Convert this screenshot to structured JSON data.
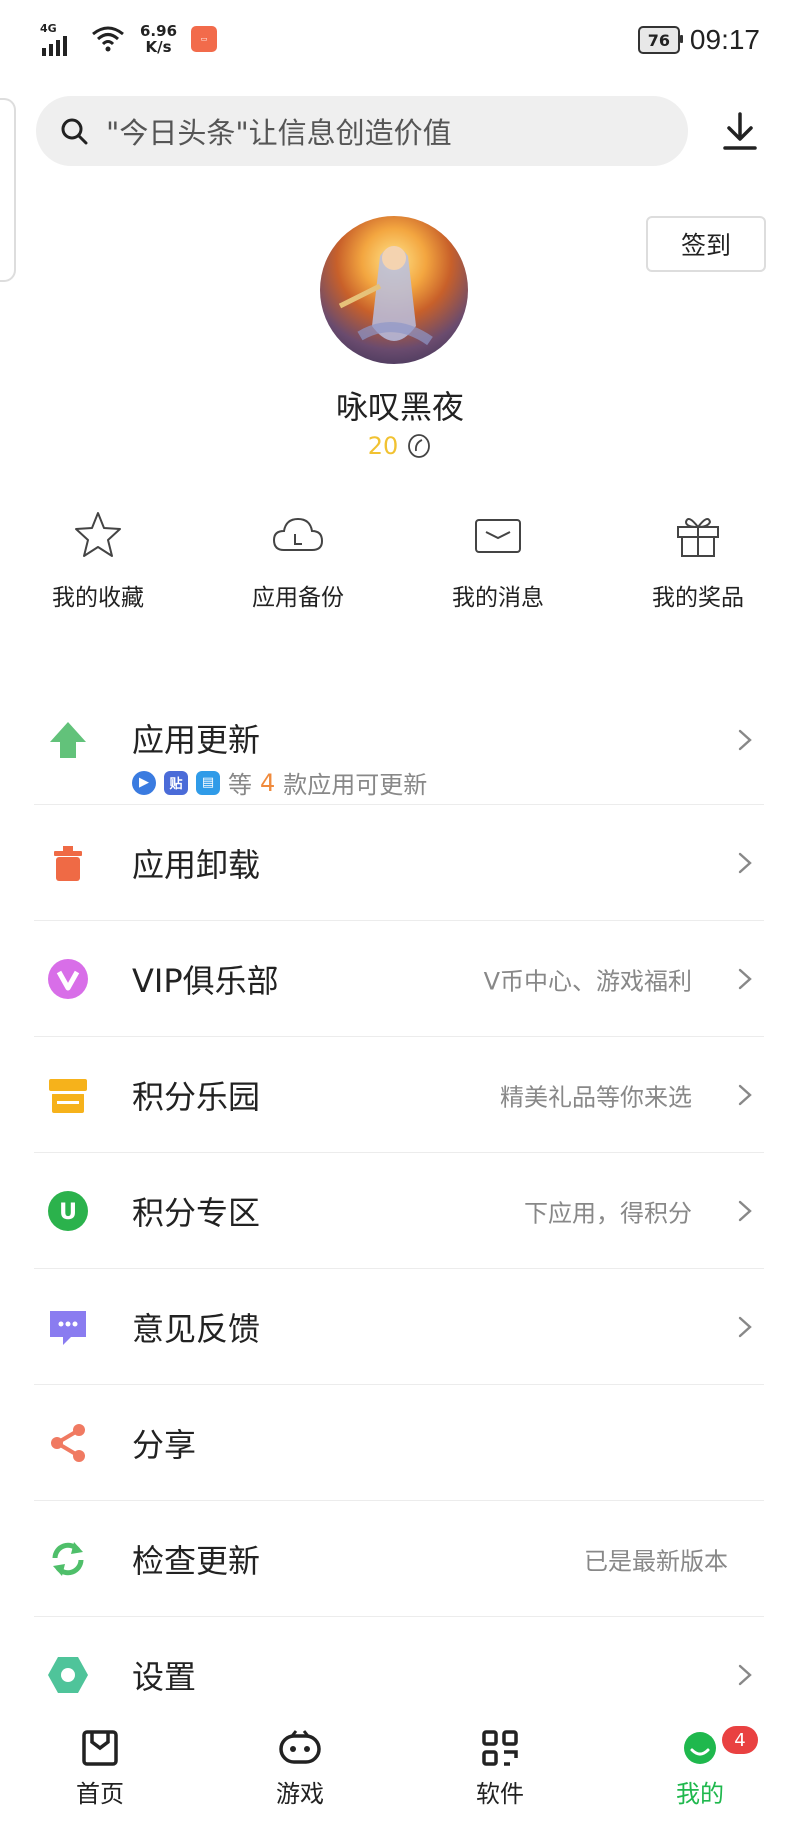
{
  "status_bar": {
    "network": "4G",
    "speed_value": "6.96",
    "speed_unit": "K/s",
    "battery": "76",
    "time": "09:17"
  },
  "search": {
    "placeholder": "\"今日头条\"让信息创造价值"
  },
  "profile": {
    "signin_label": "签到",
    "username": "咏叹黑夜",
    "points": "20"
  },
  "quick_actions": [
    {
      "label": "我的收藏",
      "icon": "star-icon"
    },
    {
      "label": "应用备份",
      "icon": "cloud-icon"
    },
    {
      "label": "我的消息",
      "icon": "envelope-icon"
    },
    {
      "label": "我的奖品",
      "icon": "gift-icon"
    }
  ],
  "menu": {
    "update": {
      "title": "应用更新",
      "sub_prefix": "等",
      "count": "4",
      "sub_suffix": "款应用可更新",
      "mini_app_2": "贴"
    },
    "uninstall": {
      "title": "应用卸载"
    },
    "vip": {
      "title": "VIP俱乐部",
      "hint": "V币中心、游戏福利"
    },
    "points_park": {
      "title": "积分乐园",
      "hint": "精美礼品等你来选"
    },
    "points_zone": {
      "title": "积分专区",
      "hint": "下应用，得积分",
      "icon_letter": "U"
    },
    "feedback": {
      "title": "意见反馈"
    },
    "share": {
      "title": "分享"
    },
    "check_update": {
      "title": "检查更新",
      "hint": "已是最新版本"
    },
    "settings": {
      "title": "设置"
    }
  },
  "tabs": [
    {
      "label": "首页"
    },
    {
      "label": "游戏"
    },
    {
      "label": "软件"
    },
    {
      "label": "我的",
      "badge": "4",
      "active": true
    }
  ],
  "colors": {
    "accent_green": "#1fb84d",
    "points_yellow": "#f1c232",
    "update_count_orange": "#f08a3c",
    "badge_red": "#e94141"
  }
}
